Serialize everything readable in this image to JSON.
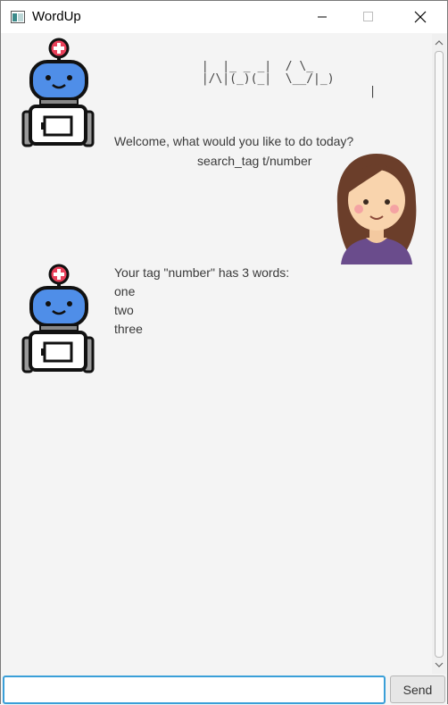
{
  "window": {
    "title": "WordUp",
    "app_icon": "window-icon",
    "controls": [
      "minimize-icon",
      "maximize-icon",
      "close-icon"
    ]
  },
  "logo_ascii": " |  |_ _ _|  / \\_\n |/\\|(_)(_|  \\__/|_)\n                         |",
  "messages": [
    {
      "sender": "bot",
      "text": "Welcome, what would you like to do today?"
    },
    {
      "sender": "user",
      "text": "search_tag t/number"
    },
    {
      "sender": "bot",
      "lines": [
        "Your tag \"number\" has 3 words:",
        "one",
        "two",
        "three"
      ]
    }
  ],
  "input": {
    "value": "",
    "placeholder": ""
  },
  "send_label": "Send",
  "colors": {
    "accent": "#3a9fd8",
    "bot_head": "#4f8ee8",
    "bot_cross": "#e8405a",
    "user_hair": "#6b3e2a",
    "user_shirt": "#6a4c8c"
  }
}
